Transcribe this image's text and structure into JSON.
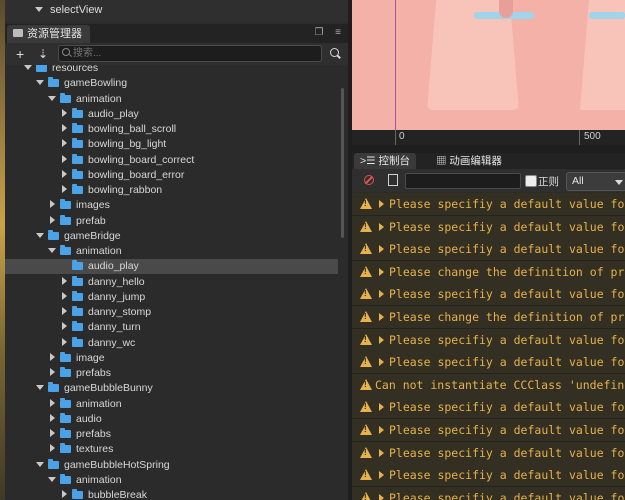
{
  "top_node": {
    "label": "selectView"
  },
  "asset_panel": {
    "title": "资源管理器",
    "add_label": "+",
    "sort_label": "⇣",
    "search_placeholder": "搜索...",
    "tree": [
      {
        "label": "resources",
        "depth": 0,
        "kind": "folder",
        "expanded": true
      },
      {
        "label": "gameBowling",
        "depth": 1,
        "kind": "folder",
        "expanded": true
      },
      {
        "label": "animation",
        "depth": 2,
        "kind": "folder",
        "expanded": true
      },
      {
        "label": "audio_play",
        "depth": 3,
        "kind": "folder",
        "expanded": false
      },
      {
        "label": "bowling_ball_scroll",
        "depth": 3,
        "kind": "folder",
        "expanded": false
      },
      {
        "label": "bowling_bg_light",
        "depth": 3,
        "kind": "folder",
        "expanded": false
      },
      {
        "label": "bowling_board_correct",
        "depth": 3,
        "kind": "folder",
        "expanded": false
      },
      {
        "label": "bowling_board_error",
        "depth": 3,
        "kind": "folder",
        "expanded": false
      },
      {
        "label": "bowling_rabbon",
        "depth": 3,
        "kind": "folder",
        "expanded": false
      },
      {
        "label": "images",
        "depth": 2,
        "kind": "folder",
        "expanded": false
      },
      {
        "label": "prefab",
        "depth": 2,
        "kind": "folder",
        "expanded": false
      },
      {
        "label": "gameBridge",
        "depth": 1,
        "kind": "folder",
        "expanded": true
      },
      {
        "label": "animation",
        "depth": 2,
        "kind": "folder",
        "expanded": true
      },
      {
        "label": "audio_play",
        "depth": 3,
        "kind": "folder",
        "expanded": null,
        "selected": true
      },
      {
        "label": "danny_hello",
        "depth": 3,
        "kind": "folder",
        "expanded": false
      },
      {
        "label": "danny_jump",
        "depth": 3,
        "kind": "folder",
        "expanded": false
      },
      {
        "label": "danny_stomp",
        "depth": 3,
        "kind": "folder",
        "expanded": false
      },
      {
        "label": "danny_turn",
        "depth": 3,
        "kind": "folder",
        "expanded": false
      },
      {
        "label": "danny_wc",
        "depth": 3,
        "kind": "folder",
        "expanded": false
      },
      {
        "label": "image",
        "depth": 2,
        "kind": "folder",
        "expanded": false
      },
      {
        "label": "prefabs",
        "depth": 2,
        "kind": "folder",
        "expanded": false
      },
      {
        "label": "gameBubbleBunny",
        "depth": 1,
        "kind": "folder",
        "expanded": true
      },
      {
        "label": "animation",
        "depth": 2,
        "kind": "folder",
        "expanded": false
      },
      {
        "label": "audio",
        "depth": 2,
        "kind": "folder",
        "expanded": false
      },
      {
        "label": "prefabs",
        "depth": 2,
        "kind": "folder",
        "expanded": false
      },
      {
        "label": "textures",
        "depth": 2,
        "kind": "folder",
        "expanded": false
      },
      {
        "label": "gameBubbleHotSpring",
        "depth": 1,
        "kind": "folder",
        "expanded": true
      },
      {
        "label": "animation",
        "depth": 2,
        "kind": "folder",
        "expanded": true
      },
      {
        "label": "bubbleBreak",
        "depth": 3,
        "kind": "folder",
        "expanded": false
      }
    ]
  },
  "scene": {
    "ruler_ticks": [
      "0",
      "500"
    ]
  },
  "console": {
    "tabs": [
      {
        "label": "控制台",
        "icon": "console-icon",
        "active": true
      },
      {
        "label": "动画编辑器",
        "icon": "film-icon",
        "active": false
      }
    ],
    "regex_label": "正则",
    "level_value": "All",
    "messages": [
      {
        "text": "Please specifiy a default value for",
        "expandable": true
      },
      {
        "text": "Please specifiy a default value for",
        "expandable": true
      },
      {
        "text": "Please specifiy a default value for",
        "expandable": true
      },
      {
        "text": "Please change the definition of pro",
        "expandable": true
      },
      {
        "text": "Please specifiy a default value for",
        "expandable": true
      },
      {
        "text": "Please change the definition of pro",
        "expandable": true
      },
      {
        "text": "Please specifiy a default value for",
        "expandable": true
      },
      {
        "text": "Please specifiy a default value for",
        "expandable": true
      },
      {
        "text": "Can not instantiate CCClass 'undefine",
        "expandable": false
      },
      {
        "text": "Please specifiy a default value for",
        "expandable": true
      },
      {
        "text": "Please specifiy a default value for",
        "expandable": true
      },
      {
        "text": "Please specifiy a default value for",
        "expandable": true
      },
      {
        "text": "Please specifiy a default value for",
        "expandable": true
      },
      {
        "text": "Please specifiy a default value for",
        "expandable": true
      }
    ]
  },
  "colors": {
    "folder": "#4aa3e8",
    "warning": "#e7b24b",
    "scene_bg": "#f4b1a8",
    "selection": "#4a4a4a"
  }
}
